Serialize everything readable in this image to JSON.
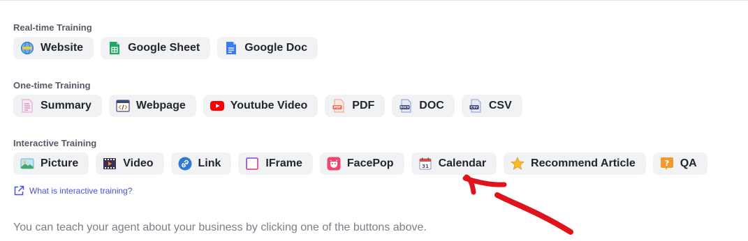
{
  "sections": {
    "realtime": {
      "title": "Real-time Training",
      "buttons": [
        "Website",
        "Google Sheet",
        "Google Doc"
      ]
    },
    "onetime": {
      "title": "One-time Training",
      "buttons": [
        "Summary",
        "Webpage",
        "Youtube Video",
        "PDF",
        "DOC",
        "CSV"
      ]
    },
    "interactive": {
      "title": "Interactive Training",
      "buttons": [
        "Picture",
        "Video",
        "Link",
        "IFrame",
        "FacePop",
        "Calendar",
        "Recommend Article",
        "QA"
      ]
    }
  },
  "help_link": "What is interactive training?",
  "footer_text": "You can teach your agent about your business by clicking one of the buttons above.",
  "icons": {
    "pdf": "PDF",
    "doc": "DOCX",
    "csv": "CSV",
    "calendar_day": "31",
    "qa": "?"
  },
  "colors": {
    "accent": "#4b4fd8",
    "chip_bg": "#f1f2f4",
    "annotation": "#e0121b"
  }
}
